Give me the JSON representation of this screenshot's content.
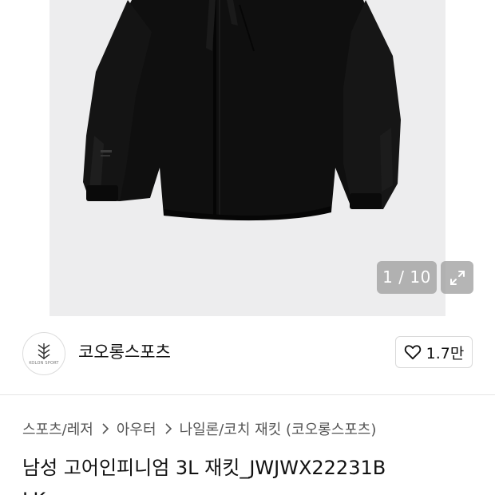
{
  "gallery": {
    "counter": "1 / 10",
    "current": 1,
    "total": 10
  },
  "store": {
    "name": "코오롱스포츠",
    "logo_text": "KOLON SPORT",
    "like_count": "1.7만"
  },
  "breadcrumb": {
    "items": [
      "스포츠/레저",
      "아우터",
      "나일론/코치 재킷 (코오롱스포츠)"
    ]
  },
  "product": {
    "title_line1": "남성 고어인피니엄 3L 재킷_JWJWX22231B",
    "title_line2": "LK"
  },
  "icons": {
    "expand": "expand-icon",
    "like": "heart-icon",
    "separator": "chevron-right-icon"
  },
  "colors": {
    "image_bg": "#ededee",
    "jacket": "#0d0d0d",
    "text_primary": "#111111",
    "text_secondary": "#555555"
  }
}
